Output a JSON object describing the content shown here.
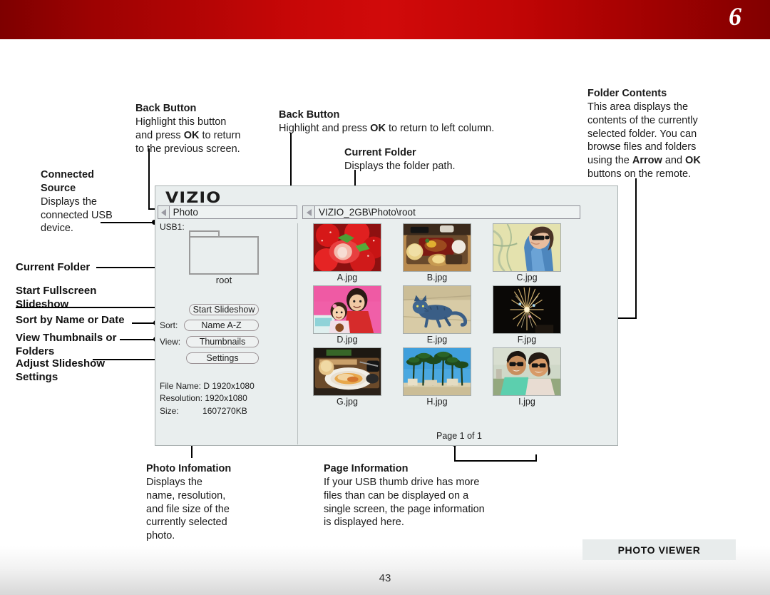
{
  "header": {
    "chapter_number": "6"
  },
  "footer": {
    "badge": "PHOTO VIEWER",
    "page_number": "43"
  },
  "annotations": {
    "back_button_left": {
      "title": "Back Button",
      "line1": "Highlight this button",
      "line2_a": "and press ",
      "line2_b": "OK",
      "line2_c": " to return",
      "line3": "to the previous screen."
    },
    "back_button_mid": {
      "title": "Back Button",
      "body_a": "Highlight and press ",
      "body_b": "OK",
      "body_c": " to return to left column."
    },
    "current_folder_mid": {
      "title": "Current Folder",
      "body": "Displays the folder path."
    },
    "folder_contents": {
      "title": "Folder Contents",
      "line1": "This area displays the",
      "line2": "contents of the currently",
      "line3": "selected folder. You can",
      "line4": "browse files and folders",
      "line5_a": "using the ",
      "line5_b": "Arrow",
      "line5_c": " and ",
      "line5_d": "OK",
      "line6": "buttons on the remote."
    },
    "connected_source": {
      "title_line1": "Connected",
      "title_line2": "Source",
      "line1": "Displays the",
      "line2": "connected USB",
      "line3": "device."
    },
    "photo_information": {
      "title": "Photo Infomation",
      "line1": "Displays the",
      "line2": "name, resolution,",
      "line3": "and file size of the",
      "line4": "currently selected",
      "line5": "photo."
    },
    "page_information": {
      "title": "Page Information",
      "line1": "If your USB thumb drive has more",
      "line2": "files than can be displayed on a",
      "line3": "single screen, the page information",
      "line4": "is displayed here."
    },
    "left_labels": {
      "current_folder": "Current Folder",
      "start_slideshow_l1": "Start Fullscreen",
      "start_slideshow_l2": "Slideshow",
      "sort": "Sort by Name or Date",
      "view_l1": "View Thumbnails or",
      "view_l2": "Folders",
      "settings_l1": "Adjust Slideshow",
      "settings_l2": "Settings"
    }
  },
  "tv_ui": {
    "logo": "VIZIO",
    "breadcrumb_left": "Photo",
    "breadcrumb_path": "VIZIO_2GB\\Photo\\root",
    "usb_label": "USB1:",
    "folder_name": "root",
    "buttons": {
      "start_slideshow": "Start Slideshow",
      "sort_label": "Sort:",
      "sort_value": "Name A-Z",
      "view_label": "View:",
      "view_value": "Thumbnails",
      "settings": "Settings"
    },
    "file_info": {
      "file_name": "File Name: D 1920x1080",
      "resolution": "Resolution: 1920x1080",
      "size": "Size:          1607270KB"
    },
    "page_info": "Page 1 of 1",
    "thumbnails": [
      {
        "caption": "A.jpg",
        "subject": "strawberries"
      },
      {
        "caption": "B.jpg",
        "subject": "food-tray"
      },
      {
        "caption": "C.jpg",
        "subject": "woman-sunglasses-map"
      },
      {
        "caption": "D.jpg",
        "subject": "children-pink"
      },
      {
        "caption": "E.jpg",
        "subject": "blue-cat"
      },
      {
        "caption": "F.jpg",
        "subject": "fireworks-dark"
      },
      {
        "caption": "G.jpg",
        "subject": "pasta-plate"
      },
      {
        "caption": "H.jpg",
        "subject": "palm-trees-sky"
      },
      {
        "caption": "I.jpg",
        "subject": "couple-selfie"
      }
    ]
  },
  "colors": {
    "banner_dark": "#7e0000",
    "banner_bright": "#d10a0a",
    "panel_bg": "#e9eeee",
    "panel_border": "#a9b0b0"
  }
}
